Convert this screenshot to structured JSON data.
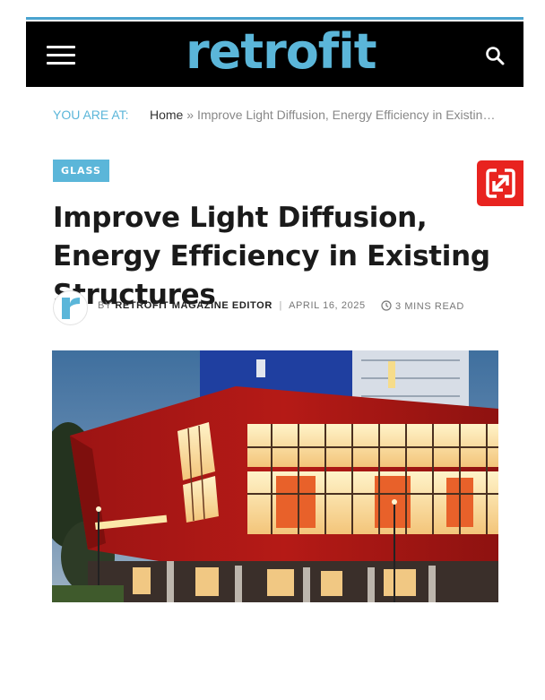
{
  "header": {
    "logo_text": "retrofit",
    "menu_icon": "hamburger-menu-icon",
    "search_icon": "search-icon",
    "brand_color": "#5bb6d9"
  },
  "breadcrumb": {
    "label": "YOU ARE AT:",
    "home": "Home",
    "separator": "»",
    "current": "Improve Light Diffusion, Energy Efficiency in Existing Structures"
  },
  "article": {
    "category": "Glass",
    "title": "Improve Light Diffusion, Energy Efficiency in Existing Structures",
    "by_label": "By",
    "author": "Retrofit Magazine Editor",
    "date": "April 16, 2025",
    "read_time": "3 Mins Read",
    "clock_icon": "clock-icon",
    "share_icon": "zoom-share-icon",
    "avatar_letter": "r"
  },
  "colors": {
    "accent": "#5bb6d9",
    "share_badge": "#e8231f",
    "header_bg": "#000000"
  }
}
